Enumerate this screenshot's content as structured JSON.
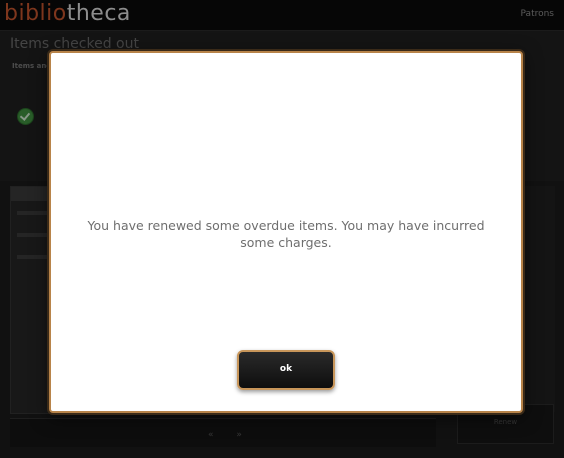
{
  "app": {
    "logo_part1": "biblio",
    "logo_part2": "theca",
    "top_right_label": "Patrons",
    "page_title": "Items checked out",
    "sub_title": "Items and renewals",
    "right_button_label": "Renew",
    "pager": "« »"
  },
  "dialog": {
    "message": "You have renewed some overdue items. You may have incurred some charges.",
    "ok_label": "ok"
  },
  "colors": {
    "accent_border": "#c8965a",
    "logo_orange": "#c2542d",
    "success_green": "#3f8f3f"
  }
}
